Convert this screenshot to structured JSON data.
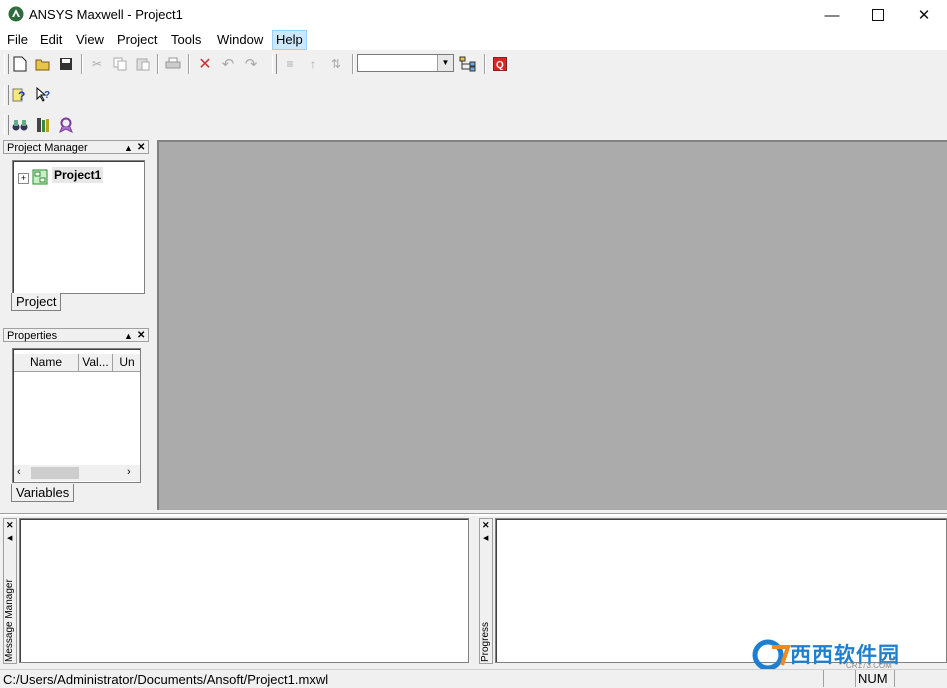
{
  "window": {
    "title": "ANSYS Maxwell - Project1"
  },
  "menu": [
    "File",
    "Edit",
    "View",
    "Project",
    "Tools",
    "Window",
    "Help"
  ],
  "toolbar": {
    "view_combo_value": ""
  },
  "project_manager": {
    "title": "Project Manager",
    "root_item": "Project1",
    "tab": "Project"
  },
  "properties": {
    "title": "Properties",
    "columns": [
      "Name",
      "Val...",
      "Un"
    ],
    "tab": "Variables"
  },
  "bottom": {
    "message_manager": "Message Manager",
    "progress": "Progress"
  },
  "status": {
    "path": "C:/Users/Administrator/Documents/Ansoft/Project1.mxwl",
    "num": "NUM"
  },
  "watermark": {
    "text": "西西软件园",
    "sub": "CR173.COM"
  },
  "colors": {
    "workspace": "#ababab",
    "accent": "#cce8ff"
  }
}
